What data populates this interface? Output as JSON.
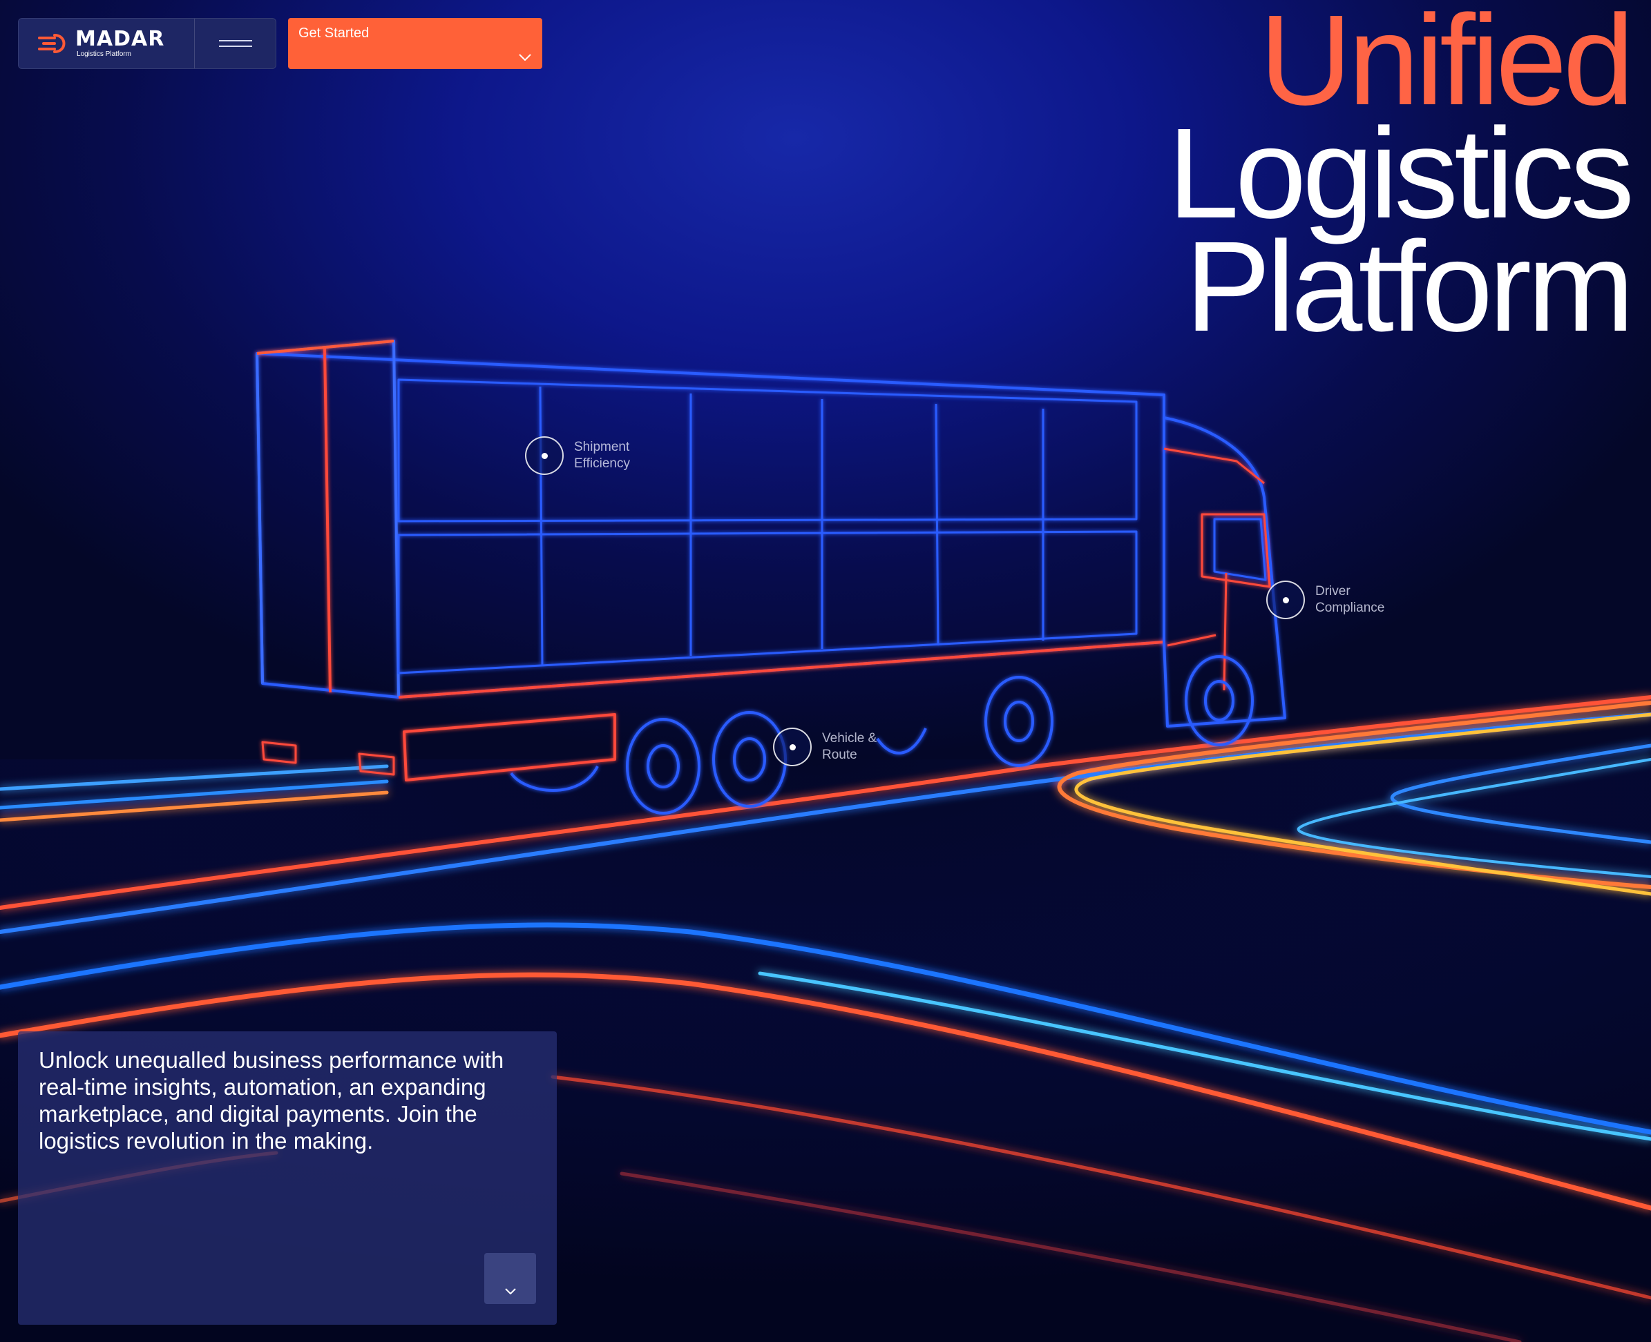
{
  "brand": {
    "name": "MADAR",
    "tagline": "Logistics Platform",
    "logo_icon": "madar-logo-mark",
    "accent_color": "#ff6138"
  },
  "nav": {
    "menu_icon": "hamburger-menu-icon",
    "cta_label": "Get Started",
    "cta_icon": "chevron-down-icon"
  },
  "hero": {
    "headline_line1": "Unified",
    "headline_line2": "Logistics",
    "headline_line3": "Platform",
    "headline_accent_color": "#ff6445",
    "hotspots": [
      {
        "label": "Shipment Efficiency"
      },
      {
        "label": "Driver Compliance"
      },
      {
        "label": "Vehicle & Route"
      }
    ]
  },
  "intro": {
    "text": "Unlock unequalled business performance with real-time insights, automation, an expanding marketplace, and digital payments. Join the logistics revolution in the making.",
    "scroll_icon": "chevron-down-icon"
  }
}
